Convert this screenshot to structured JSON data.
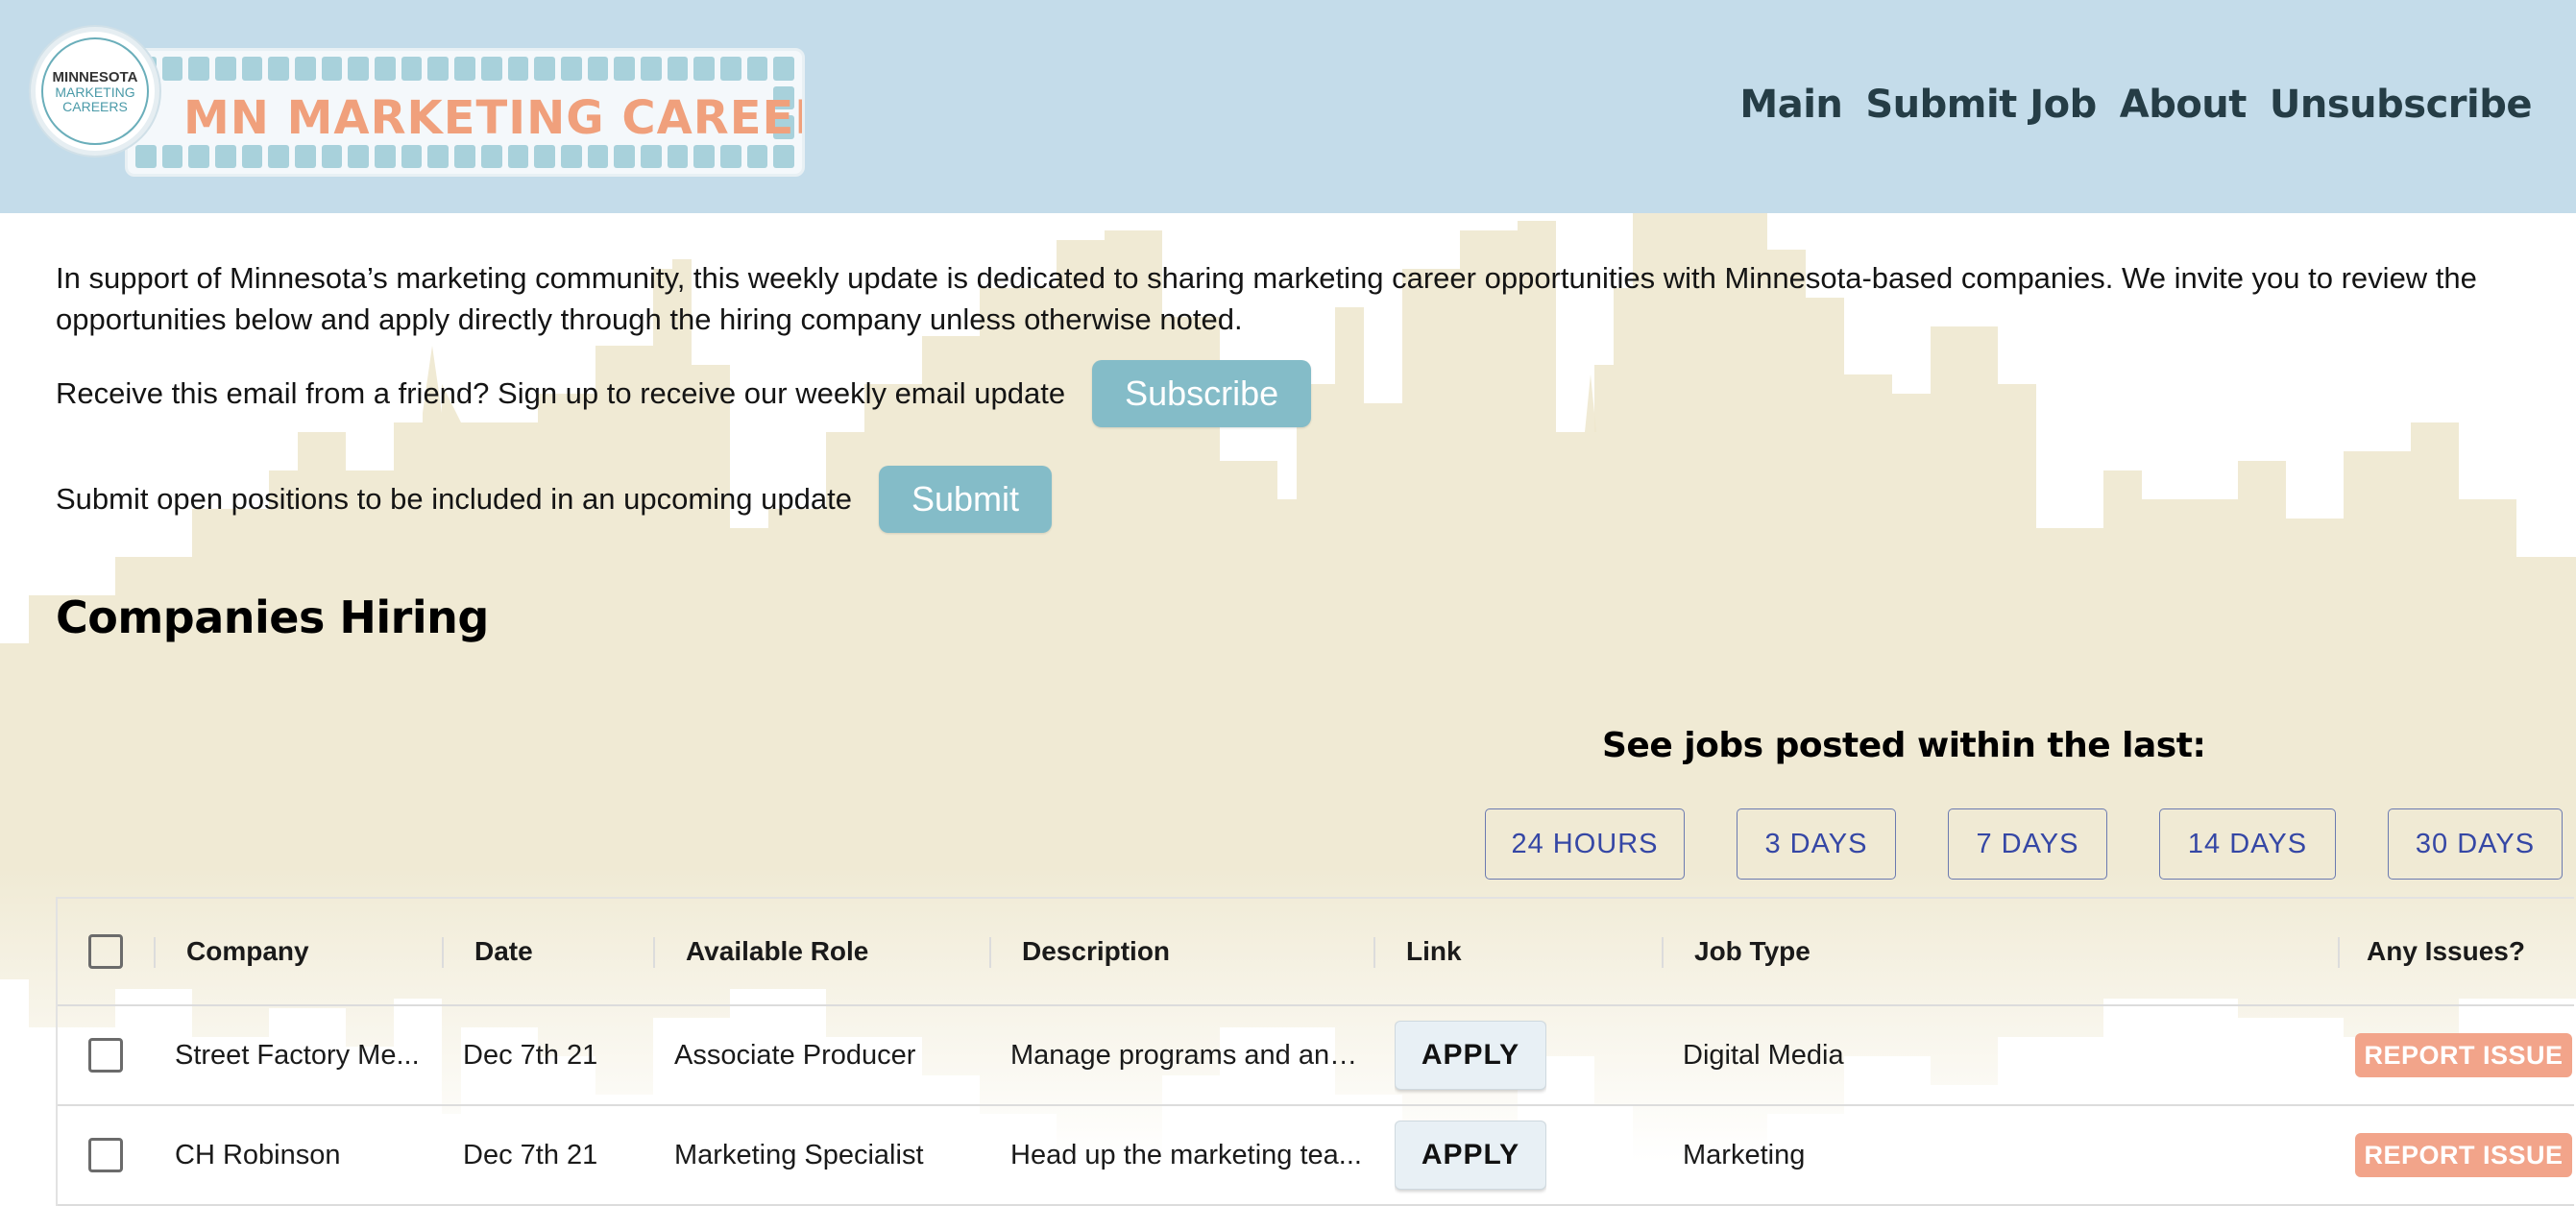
{
  "logo": {
    "circle_line1": "MINNESOTA",
    "circle_line2": "MARKETING",
    "circle_line3": "CAREERS",
    "banner_text": "MN MARKETING CAREERS"
  },
  "nav": {
    "items": [
      {
        "label": "Main"
      },
      {
        "label": "Submit Job"
      },
      {
        "label": "About"
      },
      {
        "label": "Unsubscribe"
      }
    ]
  },
  "intro": {
    "text": "In support of Minnesota’s marketing community, this weekly update is dedicated to sharing marketing career opportunities with Minnesota-based companies. We invite you to review the opportunities below and apply directly through the hiring company unless otherwise noted.",
    "subscribe_prompt": "Receive this email from a friend? Sign up to receive our weekly email update",
    "subscribe_button": "Subscribe",
    "submit_prompt": "Submit open positions to be included in an upcoming update",
    "submit_button": "Submit"
  },
  "section": {
    "heading": "Companies Hiring",
    "filter_title": "See jobs posted within the last:",
    "filters": [
      {
        "label": "24 HOURS"
      },
      {
        "label": "3 DAYS"
      },
      {
        "label": "7 DAYS"
      },
      {
        "label": "14 DAYS"
      },
      {
        "label": "30 DAYS"
      }
    ]
  },
  "table": {
    "headers": {
      "company": "Company",
      "date": "Date",
      "role": "Available Role",
      "description": "Description",
      "link": "Link",
      "job_type": "Job Type",
      "issues": "Any Issues?"
    },
    "rows": [
      {
        "company": "Street Factory Me...",
        "date": "Dec 7th 21",
        "role": "Associate Producer",
        "description": "Manage programs and ana...",
        "link": "APPLY",
        "job_type": "Digital Media",
        "issue": "REPORT ISSUE"
      },
      {
        "company": "CH Robinson",
        "date": "Dec 7th 21",
        "role": "Marketing Specialist",
        "description": "Head up the marketing tea...",
        "link": "APPLY",
        "job_type": "Marketing",
        "issue": "REPORT ISSUE"
      }
    ]
  },
  "colors": {
    "header_bg": "#c4dcea",
    "nav_text": "#253d46",
    "teal_button": "#84bcc8",
    "filter_text": "#3547a5",
    "report_button": "#f2a48a",
    "logo_text": "#f0a07c",
    "skyline": "#ede6cc"
  }
}
